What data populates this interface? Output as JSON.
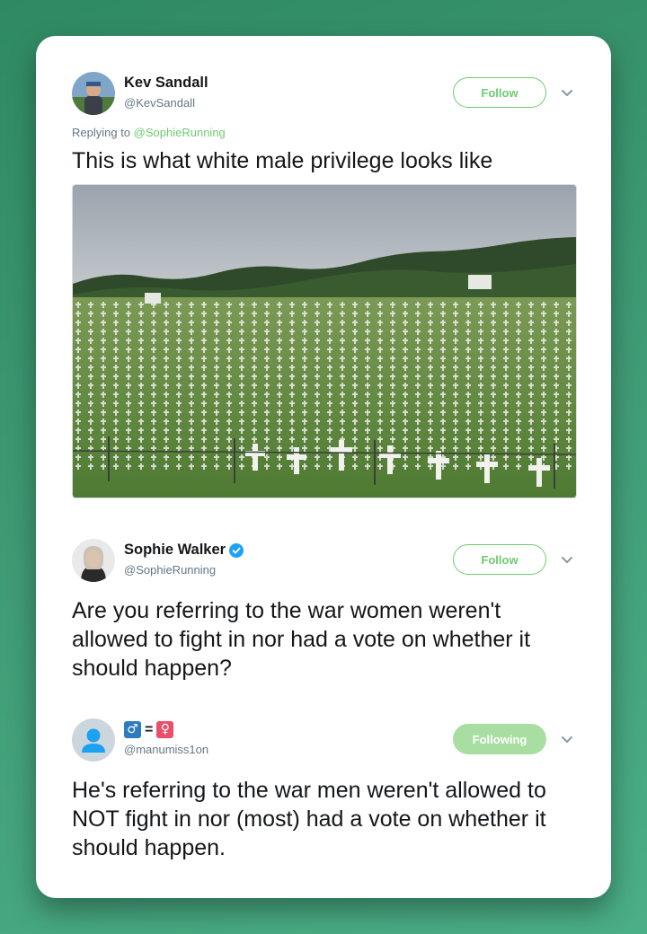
{
  "tweet1": {
    "name": "Kev Sandall",
    "handle": "@KevSandall",
    "follow_label": "Follow",
    "replying_prefix": "Replying to",
    "replying_mention": "@SophieRunning",
    "text": "This is what white male privilege looks like"
  },
  "tweet2": {
    "name": "Sophie Walker",
    "handle": "@SophieRunning",
    "follow_label": "Follow",
    "text": "Are you referring to the war women weren't allowed to fight in nor had a vote on whether it should happen?"
  },
  "tweet3": {
    "name_male": "♂",
    "name_equals": "=",
    "name_female": "♀",
    "handle": "@manumiss1on",
    "follow_label": "Following",
    "text": "He's referring to the war men weren't allowed to NOT fight in nor (most) had a vote on whether it should happen."
  },
  "colors": {
    "accent": "#6ecb6f",
    "following_bg": "#a9dea3",
    "verified": "#1da1f2",
    "male_badge": "#2d7cc1",
    "female_badge": "#e8506a"
  },
  "icons": [
    "chevron-down-icon",
    "verified-badge-icon",
    "default-avatar-icon",
    "male-sign-icon",
    "female-sign-icon"
  ]
}
